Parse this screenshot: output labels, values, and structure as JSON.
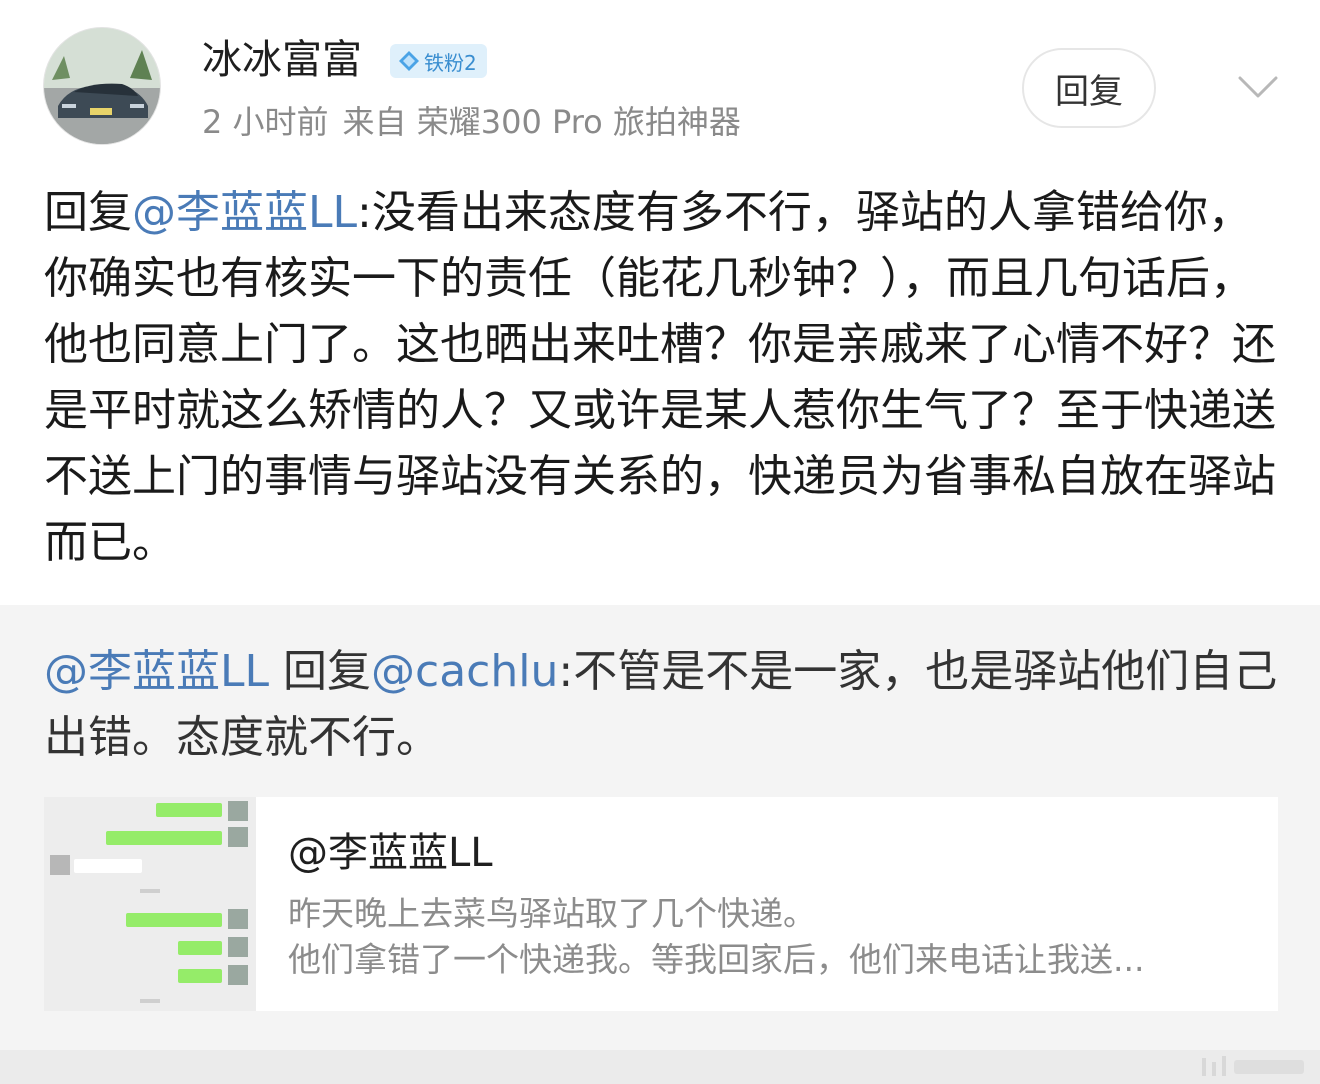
{
  "post": {
    "username": "冰冰富富",
    "fan_badge": "铁粉2",
    "time": "2 小时前",
    "source": "来自 荣耀300 Pro 旅拍神器",
    "reply_button": "回复",
    "reply_prefix": "回复",
    "reply_mention": "@李蓝蓝LL",
    "reply_body": ":没看出来态度有多不行，驿站的人拿错给你，你确实也有核实一下的责任（能花几秒钟？），而且几句话后，他也同意上门了。这也晒出来吐槽？你是亲戚来了心情不好？还是平时就这么矫情的人？又或许是某人惹你生气了？至于快递送不送上门的事情与驿站没有关系的，快递员为省事私自放在驿站而已。"
  },
  "quoted": {
    "author_mention": "@李蓝蓝LL",
    "reply_word": " 回复",
    "target_mention": "@cachlu",
    "body": ":不管是不是一家，也是驿站他们自己出错。态度就不行。",
    "card": {
      "title": "@李蓝蓝LL",
      "line1": "昨天晚上去菜鸟驿站取了几个快递。",
      "line2": "他们拿错了一个快递我。等我回家后，他们来电话让我送..."
    }
  },
  "icons": {
    "badge": "diamond-icon",
    "more": "chevron-down-icon",
    "avatar": "car-photo",
    "thumbnail": "chat-screenshot-thumbnail"
  },
  "colors": {
    "mention": "#4a7bb7",
    "meta": "#8a8a8a",
    "quote_bg": "#f4f4f4",
    "badge_bg": "#dff0fb",
    "badge_text": "#3a8ed0"
  }
}
